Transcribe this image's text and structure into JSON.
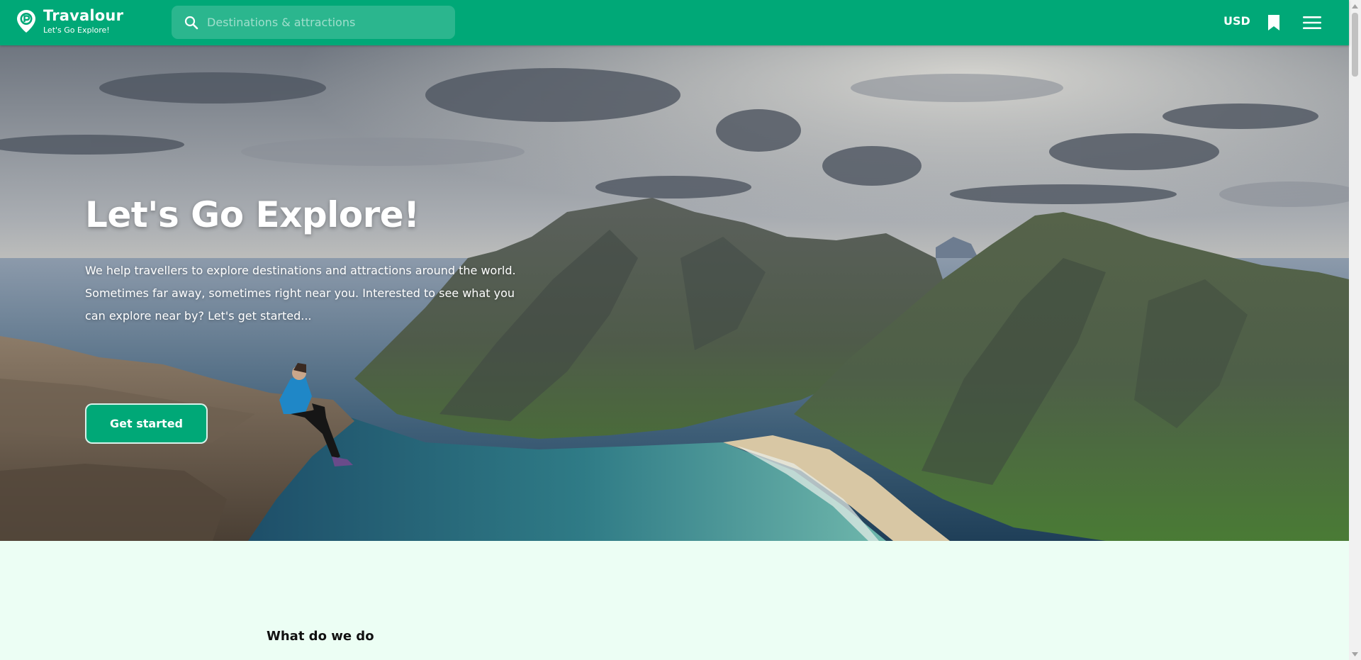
{
  "header": {
    "brand_name": "Travalour",
    "brand_tagline": "Let's Go Explore!",
    "search_placeholder": "Destinations & attractions",
    "currency": "USD",
    "icons": [
      "map-pin-logo-icon",
      "search-icon",
      "bookmark-icon",
      "hamburger-menu-icon"
    ]
  },
  "hero": {
    "title": "Let's Go Explore!",
    "description": "We help travellers to explore destinations and attractions around the world. Sometimes far away, sometimes right near you. Interested to see what you can explore near by? Let's get started...",
    "cta_label": "Get started"
  },
  "section": {
    "label": "What do we do"
  },
  "colors": {
    "brand_green": "#00a877",
    "page_background": "#ecfef4"
  }
}
